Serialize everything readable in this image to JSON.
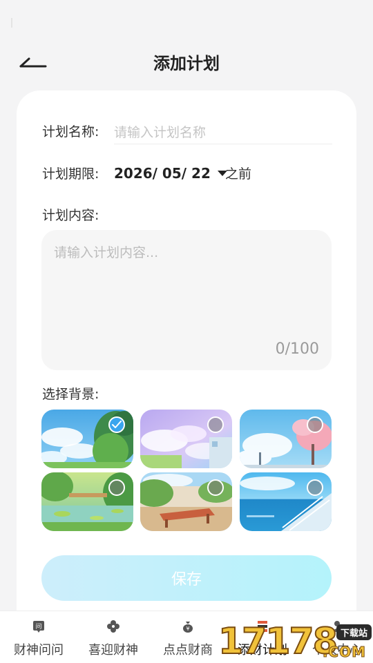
{
  "header": {
    "title": "添加计划",
    "back_icon": "back-arrow-icon"
  },
  "form": {
    "name": {
      "label": "计划名称:",
      "placeholder": "请输入计划名称",
      "value": ""
    },
    "deadline": {
      "label": "计划期限:",
      "value": "2026/ 05/ 22",
      "suffix": "之前"
    },
    "content": {
      "label": "计划内容:",
      "placeholder": "请输入计划内容...",
      "value": "",
      "counter": "0/100"
    },
    "background": {
      "label": "选择背景:",
      "options": [
        {
          "name": "blue sky with tree",
          "selected": true
        },
        {
          "name": "pastel clouds",
          "selected": false
        },
        {
          "name": "sky with pink blossoms",
          "selected": false
        },
        {
          "name": "garden pond",
          "selected": false
        },
        {
          "name": "terrace deck chair",
          "selected": false
        },
        {
          "name": "seaside stairs",
          "selected": false
        }
      ]
    },
    "save_label": "保存"
  },
  "tabbar": {
    "items": [
      {
        "label": "财神问问",
        "icon": "question-card-icon",
        "active": false
      },
      {
        "label": "喜迎财神",
        "icon": "clover-icon",
        "active": false
      },
      {
        "label": "点点财商",
        "icon": "money-bag-icon",
        "active": false
      },
      {
        "label": "添财计划",
        "icon": "plan-list-icon",
        "active": true
      },
      {
        "label": "个人中心",
        "icon": "person-icon",
        "active": false
      }
    ]
  },
  "watermark": {
    "digits": "17178",
    "badge": "下载站",
    "domain": ".COM"
  },
  "colors": {
    "accent": "#3aa5ee",
    "save_gradient_start": "#cdeefb",
    "save_gradient_end": "#b4f3fb",
    "page_bg": "#f4f4f5"
  }
}
